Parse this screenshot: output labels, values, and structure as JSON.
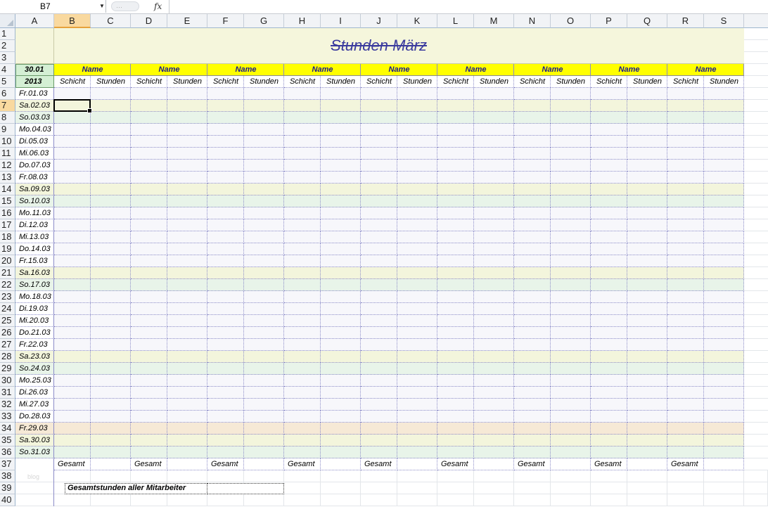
{
  "formula_bar": {
    "name_box": "B7",
    "fx_label": "fx",
    "formula": ""
  },
  "columns": [
    "A",
    "B",
    "C",
    "D",
    "E",
    "F",
    "G",
    "H",
    "I",
    "J",
    "K",
    "L",
    "M",
    "N",
    "O",
    "P",
    "Q",
    "R",
    "S"
  ],
  "selected_column": "B",
  "row_count": 40,
  "selected_row": 7,
  "title": "Stunden März",
  "corner": {
    "date": "30.01",
    "year": "2013"
  },
  "employee_header": "Name",
  "sub_headers": {
    "shift": "Schicht",
    "hours": "Stunden"
  },
  "days": [
    {
      "label": "Fr.01.03",
      "type": "weekday"
    },
    {
      "label": "Sa.02.03",
      "type": "saturday"
    },
    {
      "label": "So.03.03",
      "type": "sunday"
    },
    {
      "label": "Mo.04.03",
      "type": "weekday"
    },
    {
      "label": "Di.05.03",
      "type": "weekday"
    },
    {
      "label": "Mi.06.03",
      "type": "weekday"
    },
    {
      "label": "Do.07.03",
      "type": "weekday"
    },
    {
      "label": "Fr.08.03",
      "type": "weekday"
    },
    {
      "label": "Sa.09.03",
      "type": "saturday"
    },
    {
      "label": "So.10.03",
      "type": "sunday"
    },
    {
      "label": "Mo.11.03",
      "type": "weekday"
    },
    {
      "label": "Di.12.03",
      "type": "weekday"
    },
    {
      "label": "Mi.13.03",
      "type": "weekday"
    },
    {
      "label": "Do.14.03",
      "type": "weekday"
    },
    {
      "label": "Fr.15.03",
      "type": "weekday"
    },
    {
      "label": "Sa.16.03",
      "type": "saturday"
    },
    {
      "label": "So.17.03",
      "type": "sunday"
    },
    {
      "label": "Mo.18.03",
      "type": "weekday"
    },
    {
      "label": "Di.19.03",
      "type": "weekday"
    },
    {
      "label": "Mi.20.03",
      "type": "weekday"
    },
    {
      "label": "Do.21.03",
      "type": "weekday"
    },
    {
      "label": "Fr.22.03",
      "type": "weekday"
    },
    {
      "label": "Sa.23.03",
      "type": "saturday"
    },
    {
      "label": "So.24.03",
      "type": "sunday"
    },
    {
      "label": "Mo.25.03",
      "type": "weekday"
    },
    {
      "label": "Di.26.03",
      "type": "weekday"
    },
    {
      "label": "Mi.27.03",
      "type": "weekday"
    },
    {
      "label": "Do.28.03",
      "type": "weekday"
    },
    {
      "label": "Fr.29.03",
      "type": "holiday"
    },
    {
      "label": "Sa.30.03",
      "type": "saturday"
    },
    {
      "label": "So.31.03",
      "type": "sunday"
    }
  ],
  "total_label": "Gesamt",
  "grand_total_label": "Gesamtstunden aller Mitarbeiter",
  "watermark": "blog",
  "colors": {
    "title_bg": "#f5f6dc",
    "name_header_bg": "#ffff00",
    "corner_bg": "#d4efd4",
    "weekday_bg": "#f7f7fb",
    "saturday_bg": "#f3f5dc",
    "sunday_bg": "#e8f4e9",
    "holiday_bg": "#f6e9d6",
    "grid_line": "#8c8cc8",
    "title_color": "#3b3b9e",
    "header_text": "#1a1a8c"
  }
}
